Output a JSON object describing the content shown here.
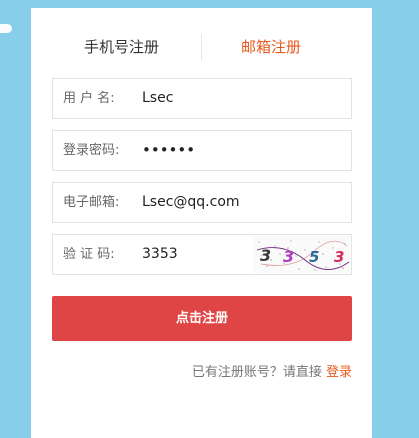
{
  "tabs": {
    "phone_label": "手机号注册",
    "email_label": "邮箱注册",
    "active": "email"
  },
  "form": {
    "username": {
      "label": "用 户 名:",
      "value": "Lsec"
    },
    "password": {
      "label": "登录密码:",
      "value": "••••••"
    },
    "email": {
      "label": "电子邮箱:",
      "value": "Lsec@qq.com"
    },
    "code": {
      "label": "验 证 码:",
      "value": "3353"
    }
  },
  "captcha": {
    "characters": [
      "3",
      "3",
      "5",
      "3"
    ],
    "colors": [
      "#3a3a3a",
      "#b13cc0",
      "#2b6a9a",
      "#d92a5b"
    ]
  },
  "submit": {
    "label": "点击注册"
  },
  "login": {
    "prompt": "已有注册账号？请直接 ",
    "link_label": "登录"
  },
  "colors": {
    "background": "#87ceeb",
    "accent": "#e85a1c",
    "button": "#e04545"
  }
}
